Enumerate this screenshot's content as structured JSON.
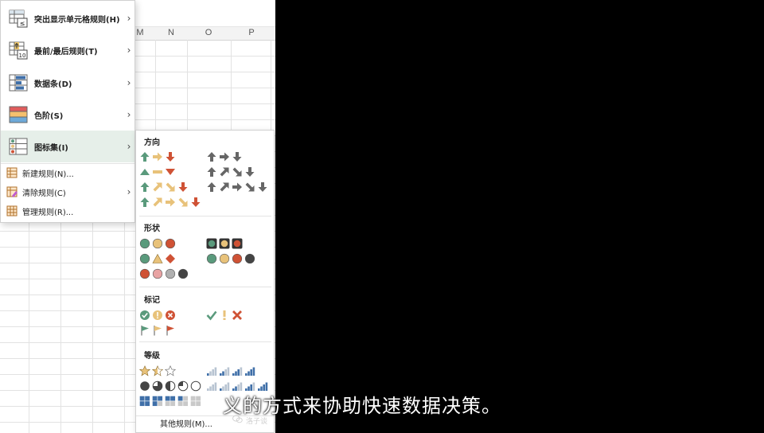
{
  "sheet": {
    "columns": [
      "M",
      "N",
      "O",
      "P"
    ]
  },
  "menu": {
    "items": [
      {
        "label": "突出显示单元格规则(H)",
        "icon": "highlight-cells-rules-icon",
        "has_submenu": true
      },
      {
        "label": "最前/最后规则(T)",
        "icon": "top-bottom-rules-icon",
        "has_submenu": true
      },
      {
        "label": "数据条(D)",
        "icon": "data-bars-icon",
        "has_submenu": true
      },
      {
        "label": "色阶(S)",
        "icon": "color-scales-icon",
        "has_submenu": true
      },
      {
        "label": "图标集(I)",
        "icon": "icon-sets-icon",
        "has_submenu": true,
        "active": true
      }
    ],
    "small_items": [
      {
        "label": "新建规则(N)...",
        "icon": "new-rule-icon"
      },
      {
        "label": "清除规则(C)",
        "icon": "clear-rules-icon",
        "has_submenu": true
      },
      {
        "label": "管理规则(R)...",
        "icon": "manage-rules-icon"
      }
    ]
  },
  "iconsets": {
    "sections": [
      {
        "title": "方向"
      },
      {
        "title": "形状"
      },
      {
        "title": "标记"
      },
      {
        "title": "等级"
      }
    ],
    "more_label": "其他规则(M)..."
  },
  "colors": {
    "green": "#5a9a7c",
    "yellow": "#e8c27a",
    "red": "#cf5235",
    "gray": "#666666",
    "pink": "#e8a3a3",
    "lightgray": "#b0b0b0",
    "dark": "#444444",
    "blue": "#3f6fa8",
    "highlight": "#e6efe9"
  },
  "subtitle": "义的方式来协助快速数据决策。",
  "watermark": "洛子谈"
}
